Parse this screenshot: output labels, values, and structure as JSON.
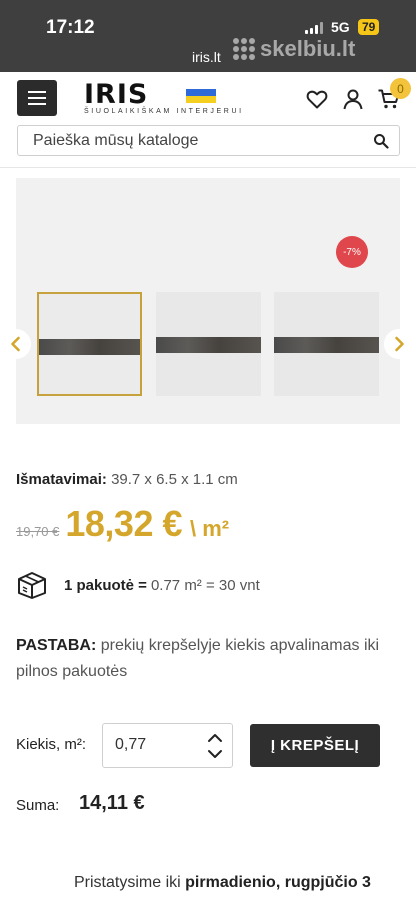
{
  "status_bar": {
    "time": "17:12",
    "network": "5G",
    "battery": "79",
    "host": "iris.lt",
    "watermark": "skelbiu.lt"
  },
  "header": {
    "logo_text": "IRIS",
    "tagline": "ŠIUOLAIKIŠKAM INTERJERUI",
    "cart_count": "0",
    "icons": [
      "menu-icon",
      "heart-icon",
      "user-icon",
      "cart-icon"
    ]
  },
  "search": {
    "placeholder": "Paieška mūsų kataloge"
  },
  "gallery": {
    "discount_badge": "-7%",
    "thumbnails": 3
  },
  "product": {
    "dimensions_label": "Išmatavimai:",
    "dimensions_value": "39.7 x 6.5 x 1.1 cm",
    "old_price": "19,70 €",
    "price": "18,32 €",
    "price_unit": "\\ m²",
    "pack_label": "1 pakuotė =",
    "pack_value": "0.77 m² = 30 vnt",
    "note_label": "PASTABA:",
    "note_text": "prekių krepšelyje kiekis apvalinamas iki pilnos pakuotės",
    "quantity_label": "Kiekis, m²:",
    "quantity_value": "0,77",
    "add_to_cart": "Į KREPŠELĮ",
    "sum_label": "Suma:",
    "sum_value": "14,11 €",
    "delivery_prefix": "Pristatysime iki",
    "delivery_date": "pirmadienio, rugpjūčio 3"
  },
  "colors": {
    "accent": "#d4a72c",
    "discount": "#e0474c",
    "dark": "#2f2f2f"
  }
}
